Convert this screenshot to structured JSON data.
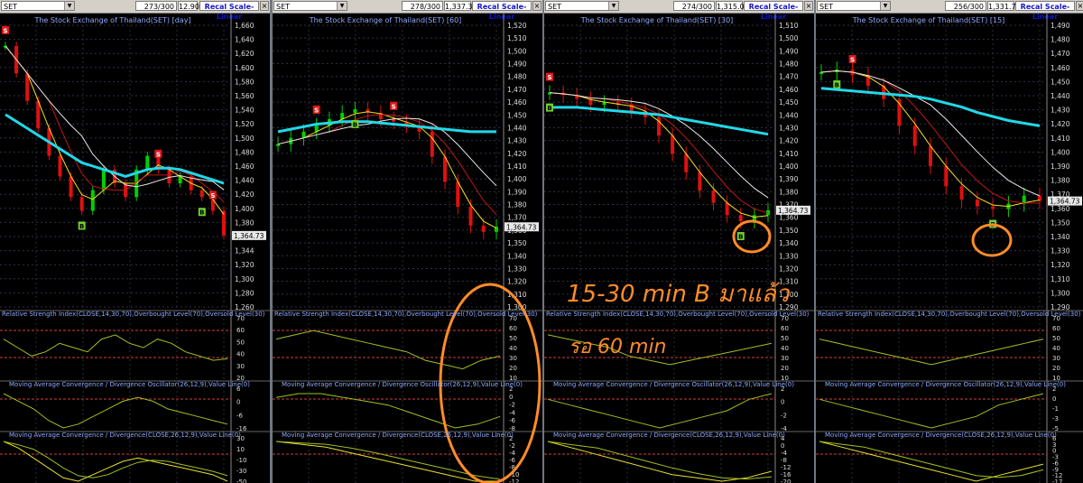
{
  "panels": [
    {
      "symbol": "SET",
      "counter": "273/300",
      "readout": "12.90",
      "recal_label": "Recal Scale-Linear",
      "title": "The Stock Exchange of Thailand(SET) [day]",
      "price_ticks": [
        "1,660",
        "1,640",
        "1,620",
        "1,600",
        "1,580",
        "1,560",
        "1,540",
        "1,520",
        "1,500",
        "1,480",
        "1,460",
        "1,440",
        "1,420",
        "1,400",
        "1,380",
        "1,360",
        "1,344",
        "1,320",
        "1,300",
        "1,280",
        "1,260"
      ],
      "last_label": "1,364.73",
      "rsi_title": "Relative Strength Index(CLOSE,14,30,70),Overbought Level(70),Oversold Level(30)",
      "rsi_ticks": [
        "70",
        "60",
        "50",
        "40",
        "30",
        "20"
      ],
      "macd_title": "Moving Average Convergence / Divergence Oscillator(26,12,9),Value Line(0)",
      "macd_ticks": [
        "6",
        "0",
        "-6",
        "-16"
      ],
      "macd2_title": "Moving Average Convergence / Divergence(CLOSE,26,12,9),Value Line(0)",
      "macd2_ticks": [
        "30",
        "10",
        "-10",
        "-30",
        "-50"
      ]
    },
    {
      "symbol": "SET",
      "counter": "278/300",
      "readout": "1,337.34",
      "recal_label": "Recal Scale-Linear",
      "title": "The Stock Exchange of Thailand(SET) [60]",
      "price_ticks": [
        "1,520",
        "1,510",
        "1,500",
        "1,490",
        "1,480",
        "1,470",
        "1,460",
        "1,450",
        "1,440",
        "1,430",
        "1,420",
        "1,410",
        "1,400",
        "1,390",
        "1,380",
        "1,370",
        "1,360",
        "1,350",
        "1,340",
        "1,330",
        "1,320",
        "1,310",
        "1,300"
      ],
      "last_label": "1,364.73",
      "rsi_title": "Relative Strength Index(CLOSE,14,30,70),Overbought Level(70),Oversold Level(30)",
      "rsi_ticks": [
        "70",
        "60",
        "50",
        "40",
        "30",
        "20",
        "10"
      ],
      "macd_title": "Moving Average Convergence / Divergence Oscillator(26,12,9),Value Line(0)",
      "macd_ticks": [
        "2",
        "0",
        "-2",
        "-4",
        "-6",
        "-8"
      ],
      "macd2_title": "Moving Average Convergence / Divergence(CLOSE,26,12,9),Value Line(0)",
      "macd2_ticks": [
        "2",
        "-2",
        "-4",
        "-6",
        "-8",
        "-10",
        "-12"
      ]
    },
    {
      "symbol": "SET",
      "counter": "274/300",
      "readout": "1,315.06",
      "recal_label": "Recal Scale-Linear",
      "title": "The Stock Exchange of Thailand(SET) [30]",
      "price_ticks": [
        "1,510",
        "1,500",
        "1,490",
        "1,480",
        "1,470",
        "1,460",
        "1,450",
        "1,440",
        "1,430",
        "1,420",
        "1,410",
        "1,400",
        "1,390",
        "1,380",
        "1,370",
        "1,360",
        "1,350",
        "1,340",
        "1,330",
        "1,320",
        "1,310",
        "1,300",
        "1,290"
      ],
      "last_label": "1,364.73",
      "rsi_title": "Relative Strength Index(CLOSE,14,30,70),Overbought Level(70),Oversold Level(30)",
      "rsi_ticks": [
        "70",
        "60",
        "50",
        "40",
        "30",
        "20",
        "10"
      ],
      "macd_title": "Moving Average Convergence / Divergence Oscillator(26,12,9),Value Line(0)",
      "macd_ticks": [
        "2",
        "0",
        "-2",
        "-4"
      ],
      "macd2_title": "Moving Average Convergence / Divergence(CLOSE,26,12,9),Value Line(0)",
      "macd2_ticks": [
        "4",
        "0",
        "-4",
        "-8",
        "-12",
        "-16",
        "-20"
      ]
    },
    {
      "symbol": "SET",
      "counter": "256/300",
      "readout": "1,331.76",
      "recal_label": "Recal Scale-Linear",
      "title": "The Stock Exchange of Thailand(SET) [15]",
      "price_ticks": [
        "1,490",
        "1,480",
        "1,470",
        "1,460",
        "1,450",
        "1,440",
        "1,430",
        "1,420",
        "1,410",
        "1,400",
        "1,390",
        "1,380",
        "1,370",
        "1,360",
        "1,350",
        "1,340",
        "1,330",
        "1,320",
        "1,310",
        "1,300",
        "1,290"
      ],
      "last_label": "1,364.73",
      "rsi_title": "Relative Strength Index(CLOSE,14,30,70),Overbought Level(70),Oversold Level(30)",
      "rsi_ticks": [
        "70",
        "60",
        "50",
        "40",
        "30",
        "20",
        "10"
      ],
      "macd_title": "Moving Average Convergence / Divergence Oscillator(26,12,9),Value Line(0)",
      "macd_ticks": [
        "2",
        "0",
        "-1",
        "-3",
        "-5"
      ],
      "macd2_title": "Moving Average Convergence / Divergence(CLOSE,26,12,9),Value Line(0)",
      "macd2_ticks": [
        "6",
        "3",
        "0",
        "-3",
        "-6",
        "-9",
        "-12",
        "-17"
      ]
    }
  ],
  "annotations": {
    "line1": "15-30 min B มาแล้ว",
    "line2": "รอ 60 min",
    "color": "#ff8c28"
  },
  "chart_data": [
    {
      "type": "line",
      "timeframe": "day",
      "y": [
        1640,
        1600,
        1560,
        1520,
        1480,
        1450,
        1420,
        1400,
        1430,
        1460,
        1440,
        1420,
        1460,
        1480,
        1460,
        1440,
        1450,
        1430,
        1420,
        1400,
        1364
      ],
      "ma_long": [
        1540,
        1530,
        1520,
        1510,
        1500,
        1490,
        1480,
        1470,
        1465,
        1460,
        1455,
        1450,
        1455,
        1460,
        1462,
        1462,
        1460,
        1455,
        1450,
        1445,
        1440
      ],
      "ylim": [
        1260,
        1670
      ],
      "signals": [
        {
          "label": "S",
          "i": 0
        },
        {
          "label": "B",
          "i": 7
        },
        {
          "label": "S",
          "i": 14
        },
        {
          "label": "S",
          "i": 19
        },
        {
          "label": "B",
          "i": 18
        }
      ],
      "rsi": [
        55,
        45,
        35,
        40,
        50,
        45,
        40,
        55,
        60,
        50,
        45,
        55,
        50,
        40,
        35,
        30,
        32
      ],
      "macd_hist": [
        6,
        2,
        -2,
        -8,
        -12,
        -10,
        -6,
        -2,
        2,
        4,
        2,
        -2,
        -4,
        -6,
        -8,
        -10
      ],
      "macd_line": [
        30,
        20,
        5,
        -10,
        -25,
        -30,
        -20,
        -10,
        0,
        5,
        0,
        -5,
        -10,
        -15,
        -20,
        -30
      ]
    },
    {
      "type": "line",
      "timeframe": "60",
      "y": [
        1430,
        1435,
        1440,
        1445,
        1450,
        1455,
        1458,
        1455,
        1450,
        1448,
        1445,
        1440,
        1420,
        1400,
        1380,
        1365,
        1360,
        1364
      ],
      "ma_long": [
        1440,
        1442,
        1444,
        1446,
        1447,
        1448,
        1448,
        1448,
        1447,
        1446,
        1445,
        1444,
        1443,
        1442,
        1441,
        1440,
        1440,
        1440
      ],
      "ylim": [
        1300,
        1525
      ],
      "signals": [
        {
          "label": "S",
          "i": 3
        },
        {
          "label": "B",
          "i": 6
        },
        {
          "label": "S",
          "i": 9
        }
      ],
      "rsi": [
        55,
        60,
        65,
        60,
        55,
        50,
        45,
        40,
        30,
        25,
        20,
        30,
        35
      ],
      "macd_hist": [
        0,
        1,
        1,
        0,
        -1,
        -2,
        -4,
        -6,
        -8,
        -7,
        -5
      ],
      "macd_line": [
        2,
        1,
        0,
        -2,
        -4,
        -6,
        -8,
        -10,
        -12,
        -12
      ]
    },
    {
      "type": "line",
      "timeframe": "30",
      "y": [
        1460,
        1458,
        1455,
        1450,
        1452,
        1450,
        1445,
        1440,
        1425,
        1410,
        1395,
        1380,
        1370,
        1360,
        1355,
        1360,
        1364
      ],
      "ma_long": [
        1448,
        1448,
        1448,
        1447,
        1446,
        1445,
        1444,
        1443,
        1442,
        1440,
        1438,
        1436,
        1434,
        1432,
        1430,
        1428,
        1426
      ],
      "ylim": [
        1285,
        1515
      ],
      "signals": [
        {
          "label": "S",
          "i": 0
        },
        {
          "label": "B",
          "i": 0
        },
        {
          "label": "B",
          "i": 14
        }
      ],
      "rsi": [
        60,
        55,
        50,
        45,
        35,
        30,
        25,
        30,
        35,
        40,
        45,
        50
      ],
      "macd_hist": [
        1,
        0,
        -1,
        -2,
        -3,
        -4,
        -3,
        -2,
        -1,
        1,
        2
      ],
      "macd_line": [
        4,
        0,
        -4,
        -8,
        -12,
        -16,
        -18,
        -20,
        -18,
        -14
      ]
    },
    {
      "type": "line",
      "timeframe": "15",
      "y": [
        1460,
        1462,
        1458,
        1450,
        1440,
        1420,
        1405,
        1390,
        1375,
        1365,
        1360,
        1358,
        1362,
        1368,
        1364
      ],
      "ma_long": [
        1448,
        1447,
        1446,
        1445,
        1444,
        1443,
        1442,
        1440,
        1437,
        1434,
        1430,
        1427,
        1424,
        1422,
        1420
      ],
      "ylim": [
        1285,
        1495
      ],
      "signals": [
        {
          "label": "S",
          "i": 2
        },
        {
          "label": "B",
          "i": 1
        },
        {
          "label": "B",
          "i": 11
        }
      ],
      "rsi": [
        55,
        50,
        45,
        40,
        35,
        30,
        25,
        30,
        35,
        40,
        45,
        50,
        55
      ],
      "macd_hist": [
        1,
        0,
        -1,
        -2,
        -3,
        -4,
        -3,
        -2,
        0,
        1,
        2
      ],
      "macd_line": [
        6,
        3,
        0,
        -3,
        -6,
        -9,
        -12,
        -15,
        -12,
        -9,
        -6
      ]
    }
  ]
}
